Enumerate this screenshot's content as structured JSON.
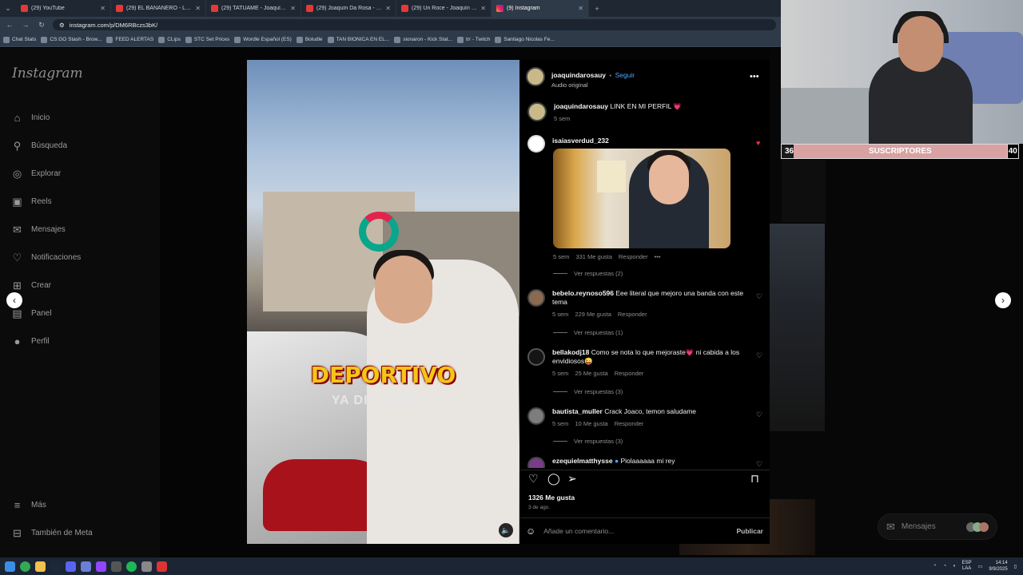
{
  "tabs": [
    {
      "title": "(29) YouTube",
      "type": "yt"
    },
    {
      "title": "(29) EL BANANERO - LA CASA",
      "type": "yt"
    },
    {
      "title": "(29) TATUAME - Joaquín Da Ro",
      "type": "yt"
    },
    {
      "title": "(29) Joaquín Da Rosa - YouTube",
      "type": "yt"
    },
    {
      "title": "(29) Un Roce - Joaquín Da Rosa",
      "type": "yt"
    },
    {
      "title": "(9) Instagram",
      "type": "ig",
      "active": true
    }
  ],
  "url": "instagram.com/p/DM6RBczs3bK/",
  "bookmarks": [
    "Chat Stats",
    "CS:GO Stash - Brow...",
    "FEED ALERTAS",
    "CLips",
    "STC Set Prices",
    "Wordle Español (ES)",
    "Boludle",
    "TAN BIONICA EN EL...",
    "sionaron - Kick Stat...",
    "trr - Twitch",
    "Santiago Nicolas Fe..."
  ],
  "sidebar": {
    "logo": "Instagram",
    "items": [
      {
        "label": "Inicio",
        "icon": "home-icon",
        "glyph": "⌂"
      },
      {
        "label": "Búsqueda",
        "icon": "search-icon",
        "glyph": "⚲"
      },
      {
        "label": "Explorar",
        "icon": "explore-icon",
        "glyph": "◎"
      },
      {
        "label": "Reels",
        "icon": "reels-icon",
        "glyph": "▣"
      },
      {
        "label": "Mensajes",
        "icon": "messages-icon",
        "glyph": "✉"
      },
      {
        "label": "Notificaciones",
        "icon": "heart-icon",
        "glyph": "♡"
      },
      {
        "label": "Crear",
        "icon": "plus-icon",
        "glyph": "⊞"
      },
      {
        "label": "Panel",
        "icon": "panel-icon",
        "glyph": "▤"
      },
      {
        "label": "Perfil",
        "icon": "profile-icon",
        "glyph": "●"
      }
    ],
    "more": "Más",
    "meta": "También de Meta"
  },
  "video": {
    "title": "DEPORTIVO",
    "subtitle": "YA DIS   ONIBLE"
  },
  "post": {
    "author": "joaquindarosauy",
    "follow": "Seguir",
    "audio": "Audio original",
    "caption": "LINK EN MI PERFIL 💗",
    "caption_time": "5 sem",
    "likes": "1326 Me gusta",
    "date": "3 de ago.",
    "add_comment": "Añade un comentario...",
    "publish": "Publicar"
  },
  "comments": [
    {
      "user": "isaiasverdud_232",
      "text": "",
      "time": "5 sem",
      "likes": "331 Me gusta",
      "reply": "Responder",
      "replies": "Ver respuestas (2)",
      "liked": true
    },
    {
      "user": "bebelo.reynoso596",
      "text": "Eee literal que mejoro una banda con este tema",
      "time": "5 sem",
      "likes": "229 Me gusta",
      "reply": "Responder",
      "replies": "Ver respuestas (1)"
    },
    {
      "user": "bellakodj18",
      "text": "Como se nota lo que mejoraste💗 ni cabida a los envidiosos😜",
      "time": "5 sem",
      "likes": "25 Me gusta",
      "reply": "Responder",
      "replies": "Ver respuestas (3)"
    },
    {
      "user": "bautista_muller",
      "text": "Crack Joaco, temon saludame",
      "time": "5 sem",
      "likes": "10 Me gusta",
      "reply": "Responder",
      "replies": "Ver respuestas (3)"
    },
    {
      "user": "ezequielmatthysse",
      "text": "Piolaaaaaa mi rey",
      "verified": true
    }
  ],
  "overlay": {
    "left": "36",
    "label": "SUSCRIPTORES",
    "right": "40",
    "fill_percent": 90
  },
  "messages_float": "Mensajes",
  "tray": {
    "lang": "ESP",
    "lang2": "LAA",
    "time": "14:14",
    "date": "9/9/2025"
  },
  "colors": {
    "accent": "#4aa8ff",
    "like": "#ff3040",
    "bar": "#d9a1a1"
  }
}
